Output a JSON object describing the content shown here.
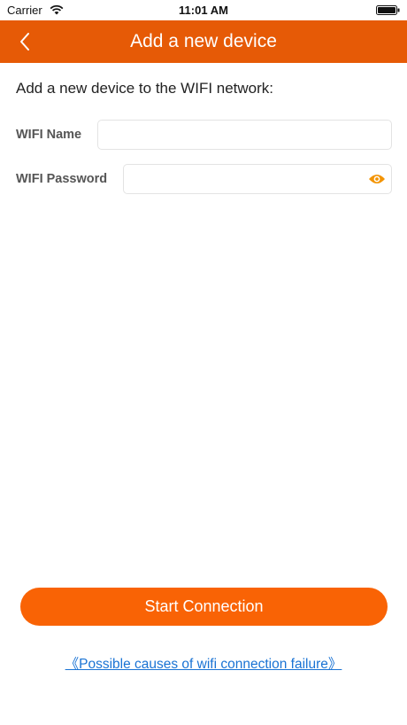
{
  "status_bar": {
    "carrier": "Carrier",
    "time": "11:01 AM",
    "wifi_icon": "wifi-icon",
    "battery_icon": "battery-icon"
  },
  "nav": {
    "title": "Add a new device",
    "back_icon": "chevron-left-icon",
    "background_color": "#e65a06"
  },
  "form": {
    "intro": "Add a new device to the WIFI network:",
    "wifi_name_label": "WIFI Name",
    "wifi_name_value": "",
    "wifi_password_label": "WIFI Password",
    "wifi_password_value": "",
    "show_password_icon": "eye-icon"
  },
  "actions": {
    "start_label": "Start Connection",
    "help_link": "《Possible causes of wifi connection failure》",
    "accent_color": "#f96305",
    "link_color": "#1a73d4"
  }
}
